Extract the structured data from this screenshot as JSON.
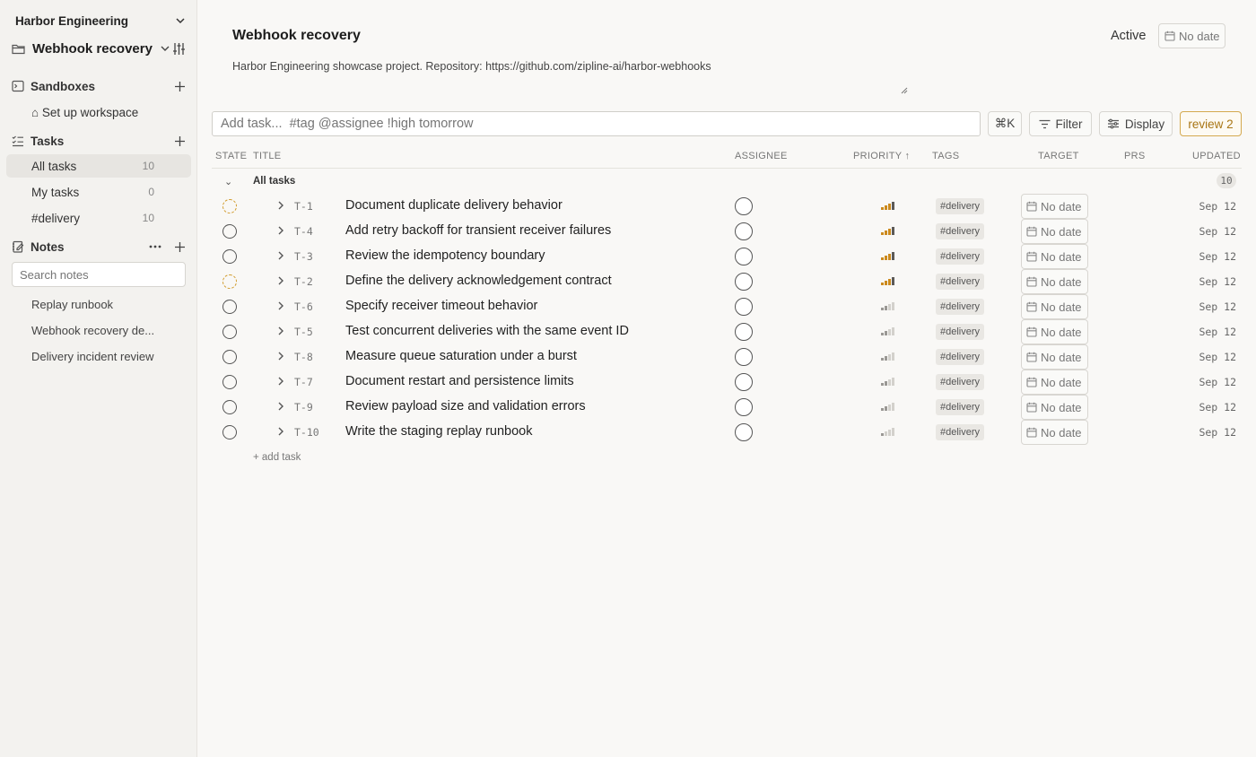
{
  "workspace": {
    "name": "Harbor Engineering"
  },
  "project": {
    "name": "Webhook recovery",
    "title": "Webhook recovery",
    "status": "Active",
    "date": "No date",
    "description": "Harbor Engineering showcase project. Repository: https://github.com/zipline-ai/harbor-webhooks"
  },
  "sidebar": {
    "sandboxes": {
      "title": "Sandboxes",
      "items": [
        {
          "label": "⌂ Set up workspace"
        }
      ]
    },
    "tasks": {
      "title": "Tasks",
      "items": [
        {
          "label": "All tasks",
          "count": "10"
        },
        {
          "label": "My tasks",
          "count": "0"
        },
        {
          "label": "#delivery",
          "count": "10"
        }
      ]
    },
    "notes": {
      "title": "Notes",
      "search_placeholder": "Search notes",
      "items": [
        {
          "label": "Replay runbook"
        },
        {
          "label": "Webhook recovery de..."
        },
        {
          "label": "Delivery incident review"
        }
      ]
    }
  },
  "toolbar": {
    "add_placeholder": "Add task...  #tag @assignee !high tomorrow",
    "shortcut": "⌘K",
    "filter": "Filter",
    "display": "Display",
    "review": "review 2"
  },
  "table": {
    "columns": {
      "state": "STATE",
      "title": "TITLE",
      "assignee": "ASSIGNEE",
      "priority": "PRIORITY ↑",
      "tags": "TAGS",
      "target": "TARGET",
      "prs": "PRS",
      "updated": "UPDATED"
    },
    "group": {
      "title": "All tasks",
      "count": "10"
    },
    "rows": [
      {
        "id": "T-1",
        "title": "Document duplicate delivery behavior",
        "state": "in-progress",
        "priority": "high",
        "tag": "#delivery",
        "target": "No date",
        "updated": "Sep 12"
      },
      {
        "id": "T-4",
        "title": "Add retry backoff for transient receiver failures",
        "state": "todo",
        "priority": "high",
        "tag": "#delivery",
        "target": "No date",
        "updated": "Sep 12"
      },
      {
        "id": "T-3",
        "title": "Review the idempotency boundary",
        "state": "todo",
        "priority": "high",
        "tag": "#delivery",
        "target": "No date",
        "updated": "Sep 12"
      },
      {
        "id": "T-2",
        "title": "Define the delivery acknowledgement contract",
        "state": "in-progress",
        "priority": "high",
        "tag": "#delivery",
        "target": "No date",
        "updated": "Sep 12"
      },
      {
        "id": "T-6",
        "title": "Specify receiver timeout behavior",
        "state": "todo",
        "priority": "medium",
        "tag": "#delivery",
        "target": "No date",
        "updated": "Sep 12"
      },
      {
        "id": "T-5",
        "title": "Test concurrent deliveries with the same event ID",
        "state": "todo",
        "priority": "medium",
        "tag": "#delivery",
        "target": "No date",
        "updated": "Sep 12"
      },
      {
        "id": "T-8",
        "title": "Measure queue saturation under a burst",
        "state": "todo",
        "priority": "medium",
        "tag": "#delivery",
        "target": "No date",
        "updated": "Sep 12"
      },
      {
        "id": "T-7",
        "title": "Document restart and persistence limits",
        "state": "todo",
        "priority": "medium",
        "tag": "#delivery",
        "target": "No date",
        "updated": "Sep 12"
      },
      {
        "id": "T-9",
        "title": "Review payload size and validation errors",
        "state": "todo",
        "priority": "medium",
        "tag": "#delivery",
        "target": "No date",
        "updated": "Sep 12"
      },
      {
        "id": "T-10",
        "title": "Write the staging replay runbook",
        "state": "todo",
        "priority": "low",
        "tag": "#delivery",
        "target": "No date",
        "updated": "Sep 12"
      }
    ],
    "add_task": "+ add task"
  },
  "colors": {
    "accent": "#cc8a1d",
    "review_border": "#d4a94f",
    "review_text": "#a87514"
  }
}
